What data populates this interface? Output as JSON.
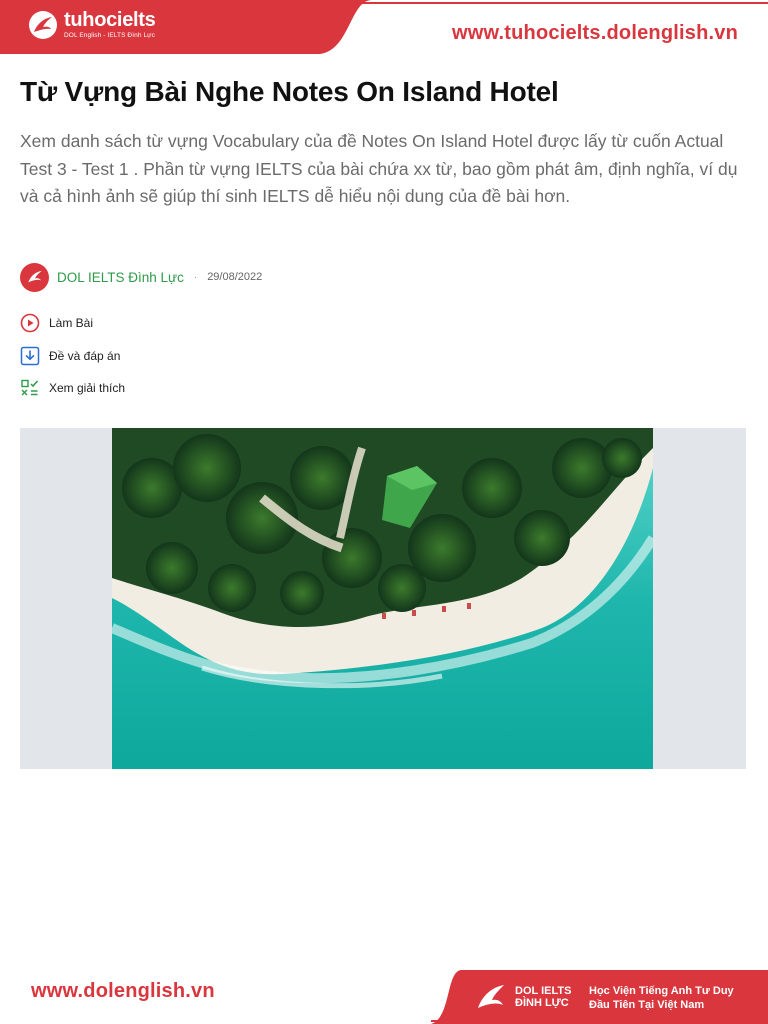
{
  "header": {
    "logo_title": "tuhocielts",
    "logo_subtitle": "DOL English - IELTS Đình Lực",
    "site_url": "www.tuhocielts.dolenglish.vn"
  },
  "article": {
    "title": "Từ Vựng Bài Nghe Notes On Island Hotel",
    "description": "Xem danh sách từ vựng Vocabulary của đề Notes On Island Hotel được lấy từ cuốn Actual Test 3 - Test 1 . Phần từ vựng IELTS của bài chứa xx từ, bao gồm phát âm, định nghĩa, ví dụ và cả hình ảnh sẽ giúp thí sinh IELTS dễ hiểu nội dung của đề bài hơn.",
    "author": "DOL IELTS Đình Lực",
    "separator": "·",
    "date": "29/08/2022",
    "actions": [
      {
        "label": "Làm Bài",
        "icon": "play-circle-icon"
      },
      {
        "label": "Đề và đáp án",
        "icon": "download-icon"
      },
      {
        "label": "Xem giải thích",
        "icon": "checklist-icon"
      }
    ]
  },
  "footer": {
    "site_url": "www.dolenglish.vn",
    "logo_line1": "DOL IELTS",
    "logo_line2": "ĐÌNH LỰC",
    "tagline_line1": "Học Viện Tiếng Anh Tư Duy",
    "tagline_line2": "Đầu Tiên Tại Việt Nam"
  },
  "colors": {
    "brand_red": "#d9363e",
    "author_green": "#2e9b4a",
    "action_blue": "#2a6fd6"
  }
}
